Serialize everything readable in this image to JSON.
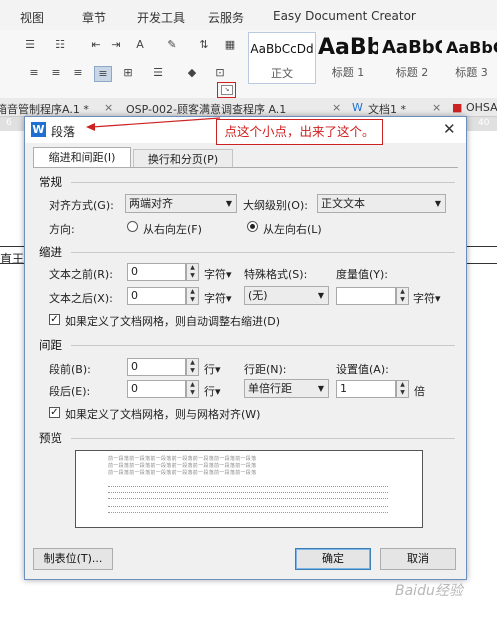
{
  "menu": [
    "视图",
    "章节",
    "开发工具",
    "云服务",
    "Easy Document Creator"
  ],
  "styles": [
    {
      "sample": "AaBbCcDd",
      "name": "正文"
    },
    {
      "sample": "AaBb",
      "name": "标题 1"
    },
    {
      "sample": "AaBbC",
      "name": "标题 2"
    },
    {
      "sample": "AaBbC",
      "name": "标题 3"
    }
  ],
  "doc_tabs": [
    "箱音管制程序A.1 *",
    "OSP-002-顾客满意调查程序 A.1",
    "文档1 *",
    "OHSA"
  ],
  "ruler": {
    "left": "6",
    "right": "40"
  },
  "doc_fragment": "直王",
  "callout": "点这个小点，出来了这个。",
  "dialog": {
    "title": "段落",
    "tabs": [
      "缩进和间距(I)",
      "换行和分页(P)"
    ],
    "general": {
      "heading": "常规",
      "alignment_label": "对齐方式(G):",
      "alignment_value": "两端对齐",
      "outline_label": "大纲级别(O):",
      "outline_value": "正文文本",
      "direction_label": "方向:",
      "rtl_label": "从右向左(F)",
      "ltr_label": "从左向右(L)"
    },
    "indent": {
      "heading": "缩进",
      "before_label": "文本之前(R):",
      "before_value": "0",
      "after_label": "文本之后(X):",
      "after_value": "0",
      "unit": "字符▾",
      "special_label": "特殊格式(S):",
      "special_value": "(无)",
      "measure_label": "度量值(Y):",
      "measure_value": "",
      "grid_check": "如果定义了文档网格，则自动调整右缩进(D)"
    },
    "spacing": {
      "heading": "间距",
      "before_label": "段前(B):",
      "before_value": "0",
      "after_label": "段后(E):",
      "after_value": "0",
      "unit": "行▾",
      "line_label": "行距(N):",
      "line_value": "单倍行距",
      "setting_label": "设置值(A):",
      "setting_value": "1",
      "setting_unit": "倍",
      "grid_check": "如果定义了文档网格，则与网格对齐(W)"
    },
    "preview_heading": "预览",
    "preview_text": "前一段落前一段落前一段落前一段落前一段落前一段落前一段落",
    "buttons": {
      "tabs": "制表位(T)...",
      "ok": "确定",
      "cancel": "取消"
    }
  },
  "watermark": "Baidu经验",
  "colors": {
    "callout_red": "#cc2222",
    "dialog_border": "#6d8fbf",
    "wps_blue": "#1f6fd0"
  }
}
